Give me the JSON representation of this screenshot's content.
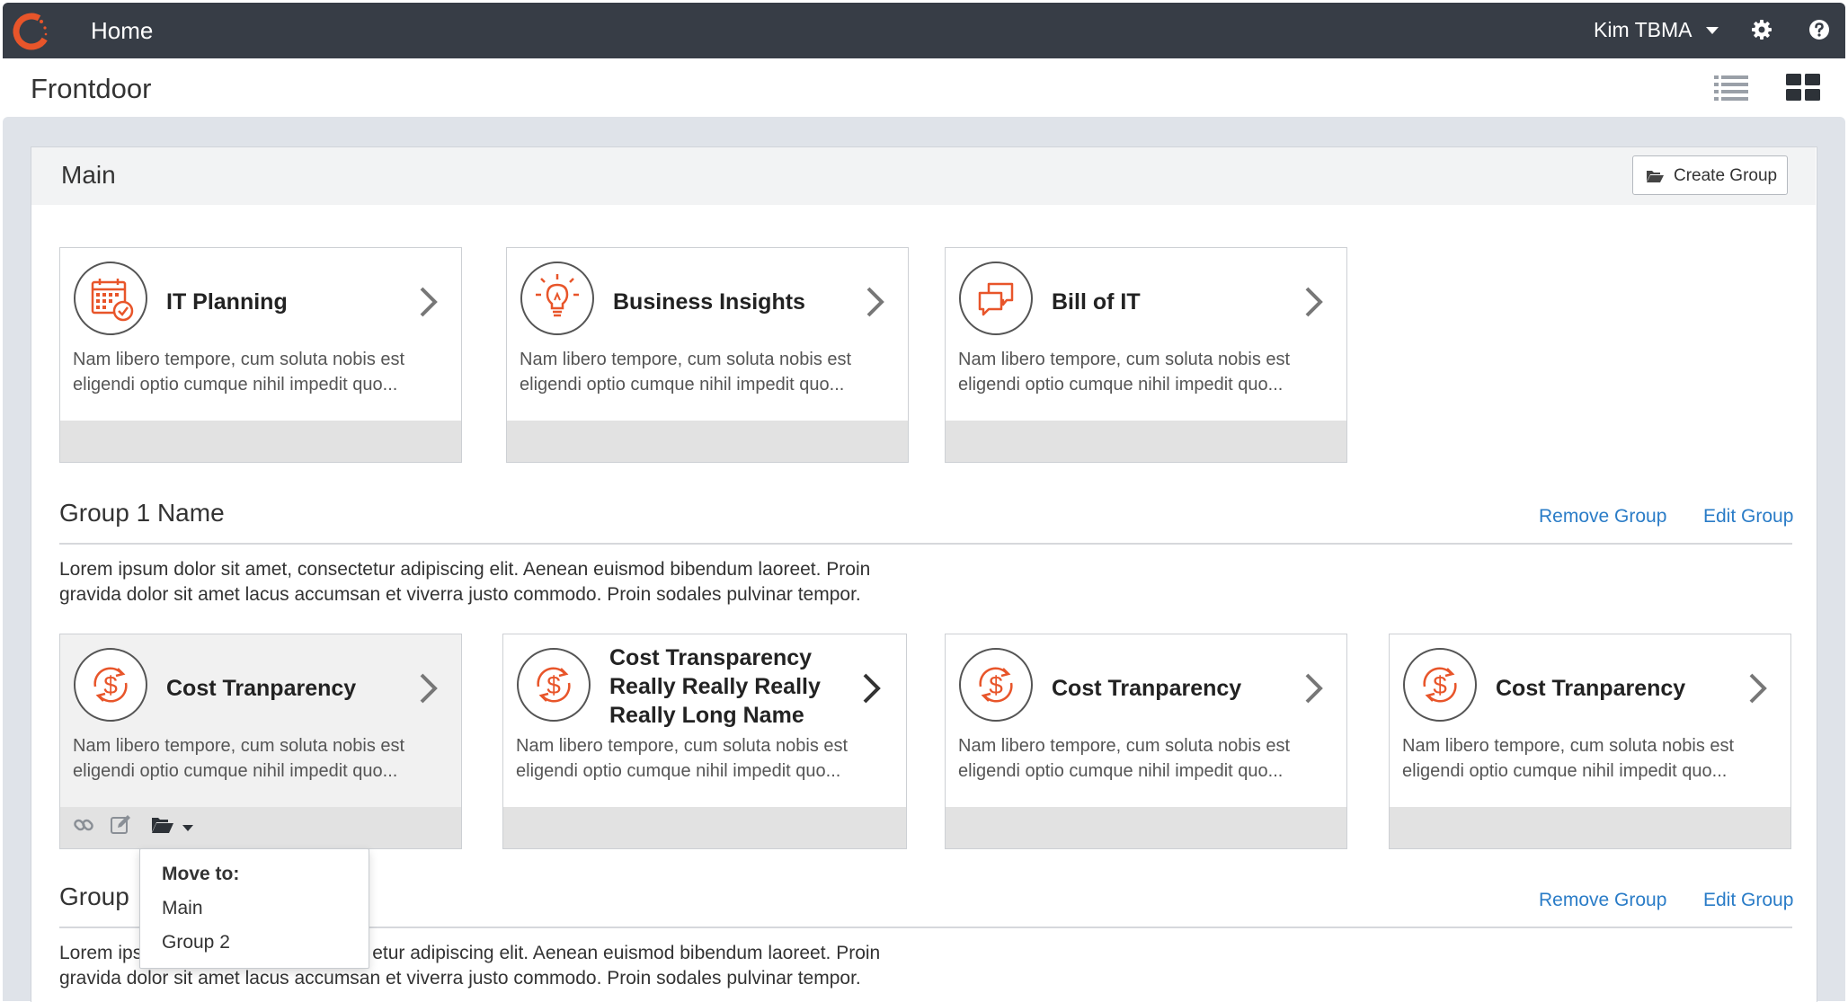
{
  "nav": {
    "home_label": "Home",
    "user_name": "Kim TBMA",
    "icons": [
      "logo-icon",
      "gear-icon",
      "help-icon"
    ]
  },
  "page": {
    "title": "Frontdoor",
    "view_icons": [
      "list-view-icon",
      "grid-view-icon"
    ]
  },
  "main_group": {
    "title": "Main",
    "create_group_label": "Create Group",
    "cards": [
      {
        "title": "IT Planning",
        "icon": "calendar-icon",
        "desc_line1": "Nam libero tempore, cum soluta nobis est",
        "desc_line2": "eligendi optio cumque nihil impedit quo..."
      },
      {
        "title": "Business Insights",
        "icon": "lightbulb-icon",
        "desc_line1": "Nam libero tempore, cum soluta nobis est",
        "desc_line2": "eligendi optio cumque nihil impedit quo..."
      },
      {
        "title": "Bill of IT",
        "icon": "chat-bubbles-icon",
        "desc_line1": "Nam libero tempore, cum soluta nobis est",
        "desc_line2": "eligendi optio cumque nihil impedit quo..."
      }
    ]
  },
  "group1": {
    "title": "Group 1 Name",
    "remove_label": "Remove Group",
    "edit_label": "Edit Group",
    "desc_line1": "Lorem ipsum dolor sit amet, consectetur adipiscing elit. Aenean euismod bibendum laoreet. Proin",
    "desc_line2": "gravida dolor sit amet lacus accumsan et viverra justo commodo. Proin sodales pulvinar tempor.",
    "cards": [
      {
        "title": "Cost Tranparency",
        "icon": "dollar-cycle-icon",
        "desc_line1": "Nam libero tempore, cum soluta nobis est",
        "desc_line2": "eligendi optio cumque nihil impedit quo..."
      },
      {
        "title_line1": "Cost Transparency",
        "title_line2": "Really Really Really",
        "title_line3": "Really Long Name",
        "icon": "dollar-cycle-icon",
        "desc_line1": "Nam libero tempore, cum soluta nobis est",
        "desc_line2": "eligendi optio cumque nihil impedit quo..."
      },
      {
        "title": "Cost Tranparency",
        "icon": "dollar-cycle-icon",
        "desc_line1": "Nam libero tempore, cum soluta nobis est",
        "desc_line2": "eligendi optio cumque nihil impedit quo..."
      },
      {
        "title": "Cost Tranparency",
        "icon": "dollar-cycle-icon",
        "desc_line1": "Nam libero tempore, cum soluta nobis est",
        "desc_line2": "eligendi optio cumque nihil impedit quo..."
      }
    ],
    "card_tools": [
      "link-icon",
      "edit-icon",
      "folder-move-icon"
    ]
  },
  "group2": {
    "title_visible": "Group",
    "remove_label": "Remove Group",
    "edit_label": "Edit Group",
    "desc_line1": "Lorem ips",
    "desc_line1_rest": "etur adipiscing elit. Aenean euismod bibendum laoreet. Proin",
    "desc_line2": "gravida dolor sit amet lacus accumsan et viverra justo commodo. Proin sodales pulvinar tempor."
  },
  "move_dropdown": {
    "header": "Move to:",
    "options": [
      "Main",
      "Group 2"
    ]
  },
  "colors": {
    "topbar": "#373d46",
    "accent_orange": "#e8552a",
    "link_blue": "#2a7cc7",
    "page_bg": "#dfe3e9"
  }
}
